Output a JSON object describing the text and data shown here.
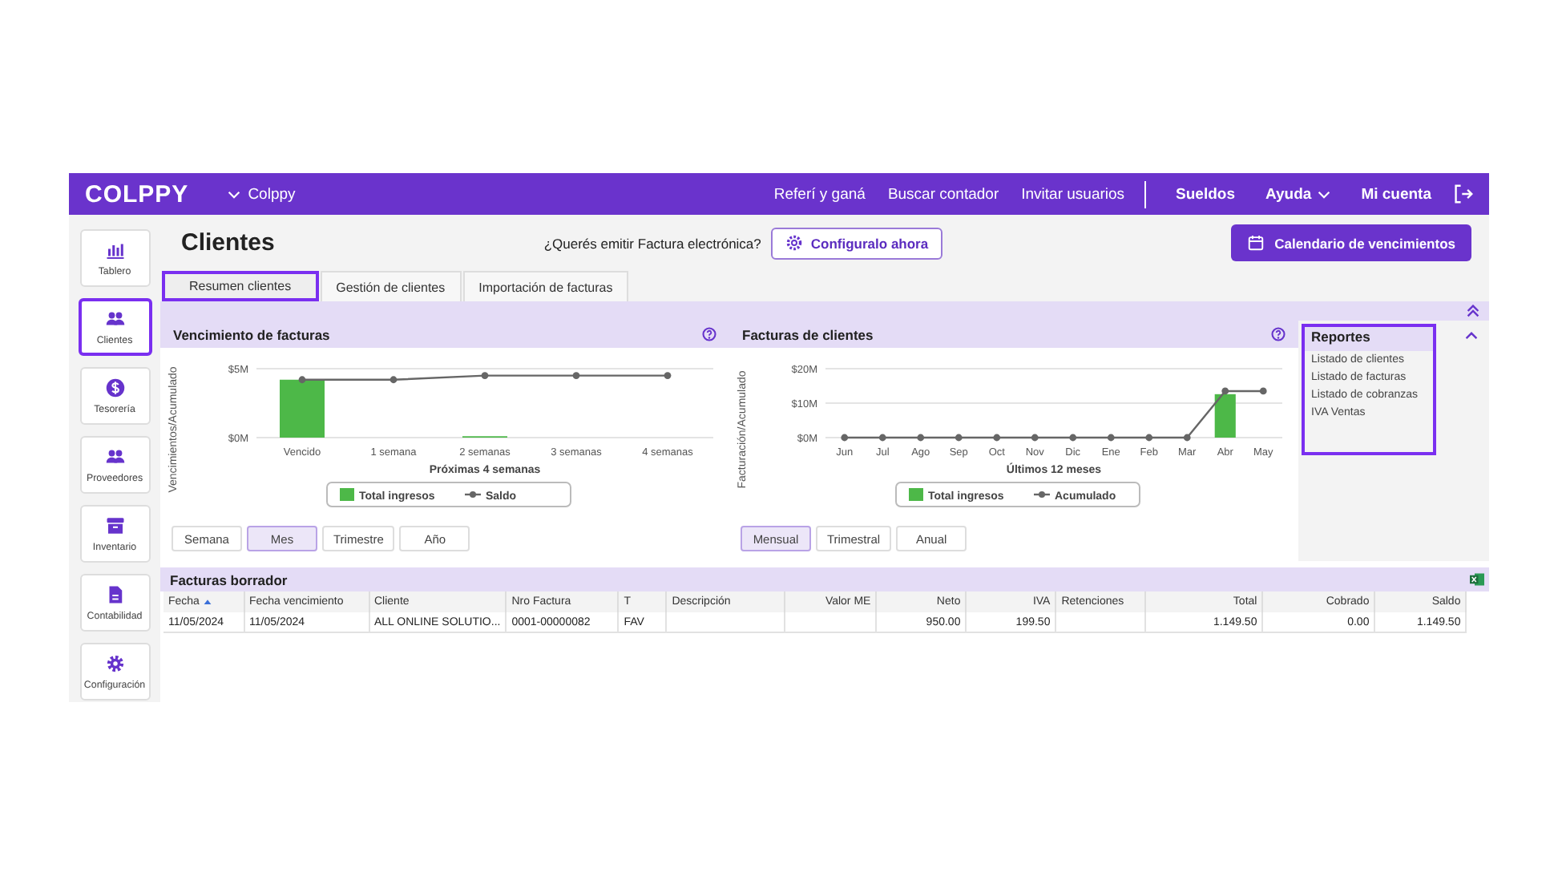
{
  "topbar": {
    "logo": "COLPPY",
    "company": "Colppy",
    "links": [
      {
        "label": "Referí y ganá",
        "emphasized": false
      },
      {
        "label": "Buscar contador",
        "emphasized": false
      },
      {
        "label": "Invitar usuarios",
        "emphasized": false
      },
      {
        "label": "Sueldos",
        "emphasized": true
      },
      {
        "label": "Ayuda",
        "emphasized": true,
        "dropdown": true
      },
      {
        "label": "Mi cuenta",
        "emphasized": true
      }
    ]
  },
  "sidebar": {
    "items": [
      {
        "label": "Tablero",
        "selected": false
      },
      {
        "label": "Clientes",
        "selected": true
      },
      {
        "label": "Tesorería",
        "selected": false
      },
      {
        "label": "Proveedores",
        "selected": false
      },
      {
        "label": "Inventario",
        "selected": false
      },
      {
        "label": "Contabilidad",
        "selected": false
      },
      {
        "label": "Configuración",
        "selected": false
      }
    ]
  },
  "header": {
    "title": "Clientes",
    "prompt": "¿Querés emitir Factura electrónica?",
    "configure_button": "Configuralo ahora",
    "calendar_button": "Calendario de vencimientos"
  },
  "tabs": [
    {
      "label": "Resumen clientes",
      "selected": true
    },
    {
      "label": "Gestión de clientes",
      "selected": false
    },
    {
      "label": "Importación de facturas",
      "selected": false
    }
  ],
  "panels": [
    {
      "periods": [
        {
          "label": "Semana",
          "selected": false
        },
        {
          "label": "Mes",
          "selected": true
        },
        {
          "label": "Trimestre",
          "selected": false
        },
        {
          "label": "Año",
          "selected": false
        }
      ],
      "chart_data": {
        "type": "bar",
        "title": "Vencimiento de facturas",
        "xlabel": "Próximas 4 semanas",
        "ylabel": "Vencimientos/Acumulado",
        "categories": [
          "Vencido",
          "1 semana",
          "2 semanas",
          "3 semanas",
          "4 semanas"
        ],
        "legend": "bottom",
        "ylim": [
          0,
          5
        ],
        "yticks": [
          {
            "value": 0,
            "label": "$0M"
          },
          {
            "value": 5,
            "label": "$5M"
          }
        ],
        "series": [
          {
            "name": "Total ingresos",
            "type": "bar",
            "color": "#4db848",
            "values": [
              4.2,
              0,
              0.1,
              0,
              0
            ]
          },
          {
            "name": "Saldo",
            "type": "line",
            "marker": "circle",
            "color": "#666666",
            "values": [
              4.2,
              4.2,
              4.5,
              4.5,
              4.5
            ]
          }
        ]
      }
    },
    {
      "periods": [
        {
          "label": "Mensual",
          "selected": true
        },
        {
          "label": "Trimestral",
          "selected": false
        },
        {
          "label": "Anual",
          "selected": false
        }
      ],
      "chart_data": {
        "type": "bar",
        "title": "Facturas de clientes",
        "xlabel": "Últimos 12 meses",
        "ylabel": "Facturación/Acumulado",
        "categories": [
          "Jun",
          "Jul",
          "Ago",
          "Sep",
          "Oct",
          "Nov",
          "Dic",
          "Ene",
          "Feb",
          "Mar",
          "Abr",
          "May"
        ],
        "legend": "bottom",
        "ylim": [
          0,
          20
        ],
        "yticks": [
          {
            "value": 0,
            "label": "$0M"
          },
          {
            "value": 10,
            "label": "$10M"
          },
          {
            "value": 20,
            "label": "$20M"
          }
        ],
        "series": [
          {
            "name": "Total ingresos",
            "type": "bar",
            "color": "#4db848",
            "values": [
              0,
              0,
              0,
              0,
              0,
              0,
              0,
              0,
              0,
              0,
              12.6,
              0
            ]
          },
          {
            "name": "Acumulado",
            "type": "line",
            "marker": "circle",
            "color": "#666666",
            "values": [
              0,
              0,
              0,
              0,
              0,
              0,
              0,
              0,
              0,
              0,
              13.5,
              13.5
            ]
          }
        ]
      }
    }
  ],
  "reports": {
    "title": "Reportes",
    "highlighted": true,
    "links": [
      "Listado de clientes",
      "Listado de facturas",
      "Listado de cobranzas",
      "IVA Ventas"
    ]
  },
  "drafts": {
    "title": "Facturas borrador",
    "columns": [
      {
        "label": "Fecha",
        "kind": "text",
        "sorted": true
      },
      {
        "label": "Fecha vencimiento",
        "kind": "text",
        "sorted": false
      },
      {
        "label": "Cliente",
        "kind": "text",
        "sorted": false
      },
      {
        "label": "Nro Factura",
        "kind": "text",
        "sorted": false
      },
      {
        "label": "T",
        "kind": "text",
        "sorted": false
      },
      {
        "label": "Descripción",
        "kind": "text",
        "sorted": false
      },
      {
        "label": "Valor ME",
        "kind": "number",
        "sorted": false
      },
      {
        "label": "Neto",
        "kind": "number",
        "sorted": false
      },
      {
        "label": "IVA",
        "kind": "number",
        "sorted": false
      },
      {
        "label": "Retenciones",
        "kind": "text",
        "sorted": false
      },
      {
        "label": "Total",
        "kind": "number",
        "sorted": false
      },
      {
        "label": "Cobrado",
        "kind": "number",
        "sorted": false
      },
      {
        "label": "Saldo",
        "kind": "number",
        "sorted": false
      }
    ],
    "rows": [
      [
        "11/05/2024",
        "11/05/2024",
        "ALL ONLINE SOLUTIO...",
        "0001-00000082",
        "FAV",
        "",
        "",
        "950.00",
        "199.50",
        "",
        "1.149.50",
        "0.00",
        "1.149.50"
      ]
    ]
  }
}
